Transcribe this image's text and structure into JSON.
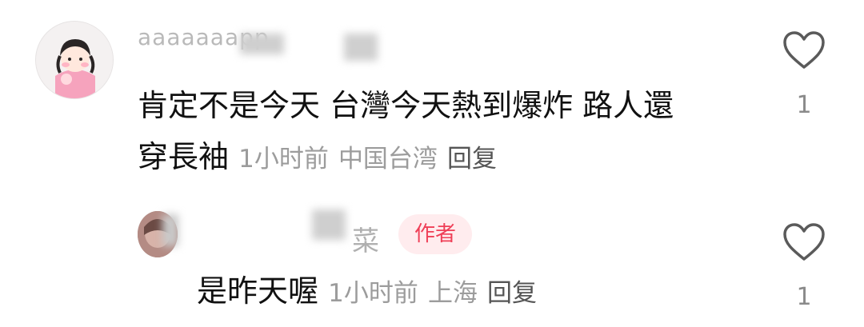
{
  "comments": [
    {
      "username": "aaaaaaapp",
      "text_line1": "肯定不是今天 台灣今天熱到爆炸 路人還",
      "text_line2": "穿長袖",
      "time": "1小时前",
      "location": "中国台湾",
      "reply_label": "回复",
      "like_count": "1",
      "like_icon": "heart-outline-icon"
    },
    {
      "username": "菜",
      "badge": "作者",
      "text": "是昨天喔",
      "time": "1小时前",
      "location": "上海",
      "reply_label": "回复",
      "like_count": "1",
      "like_icon": "heart-outline-icon"
    }
  ],
  "colors": {
    "meta_text": "#9c9c9c",
    "badge_bg": "#ffecee",
    "badge_text": "#ef3f57"
  }
}
